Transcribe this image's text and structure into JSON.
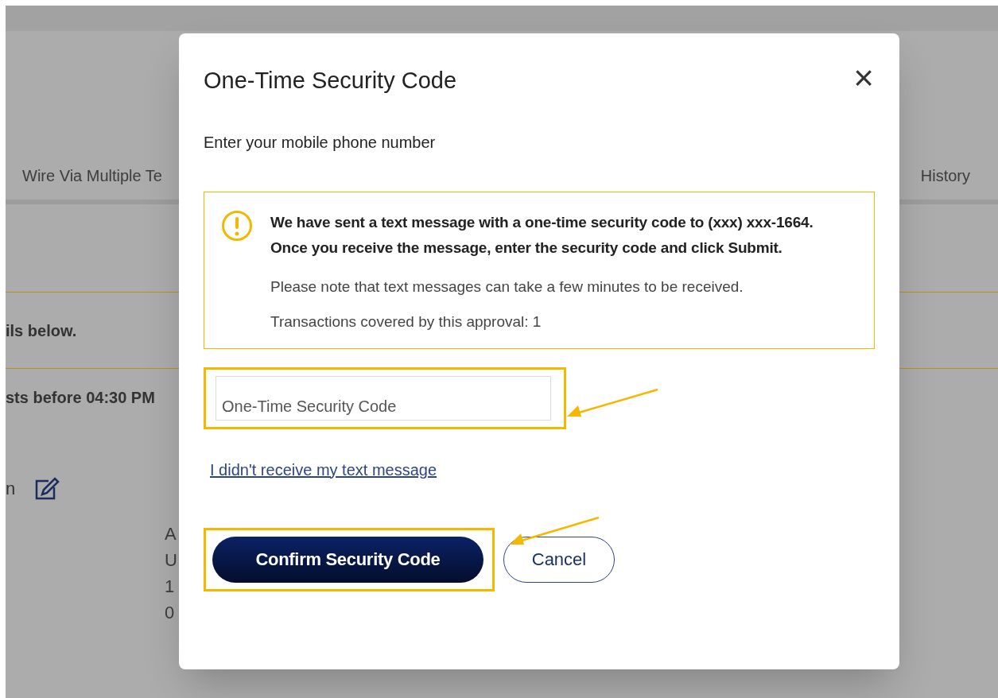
{
  "background": {
    "tabs": [
      {
        "label": "Wire Via Multiple Te"
      },
      {
        "label": "History"
      }
    ],
    "lines": [
      "ils below.",
      "sts before 04:30 PM"
    ],
    "section_label": "n",
    "address_letters": [
      "A",
      "U",
      "1",
      "0"
    ]
  },
  "dialog": {
    "title": "One-Time Security Code",
    "close": "×",
    "subtitle": "Enter your mobile phone number",
    "alert": {
      "message": "We have sent a text message with a one-time security code to (xxx) xxx-1664. Once you receive the message, enter the security code and click Submit.",
      "notes": [
        "Please note that text messages can take a few minutes to be received.",
        "Transactions covered by this approval: 1"
      ]
    },
    "code_field": {
      "placeholder": "One-Time Security Code",
      "highlighted": true
    },
    "link": "I didn't receive my text message",
    "buttons": [
      {
        "label": "Confirm Security Code",
        "kind": "primary",
        "highlighted": true
      },
      {
        "label": "Cancel",
        "kind": "secondary",
        "highlighted": false
      }
    ]
  }
}
